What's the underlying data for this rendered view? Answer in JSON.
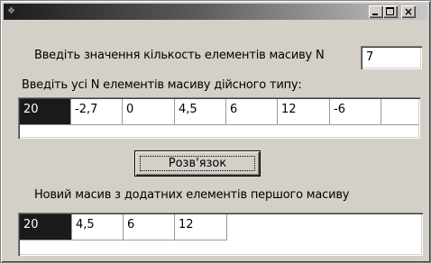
{
  "window": {
    "icon": "app-icon",
    "controls": {
      "minimize": "minimize-icon",
      "maximize": "maximize-icon",
      "close": "close-icon",
      "close_glyph": "×"
    }
  },
  "form": {
    "n_label": "Введіть значення кількость елементів масиву N",
    "n_value": "7",
    "array_label": "Введіть усі N елементів масиву дійсного типу:",
    "input_array": [
      "20",
      "-2,7",
      "0",
      "4,5",
      "6",
      "12",
      "-6",
      ""
    ],
    "solve_button": "Розв'язок",
    "result_label": "Новий масив з додатних елементів першого масиву",
    "result_array": [
      "20",
      "4,5",
      "6",
      "12",
      ""
    ]
  },
  "colors": {
    "face": "#d4d0c8",
    "selected_cell": "#1a1a1a",
    "grid_bg": "#ffffff"
  }
}
